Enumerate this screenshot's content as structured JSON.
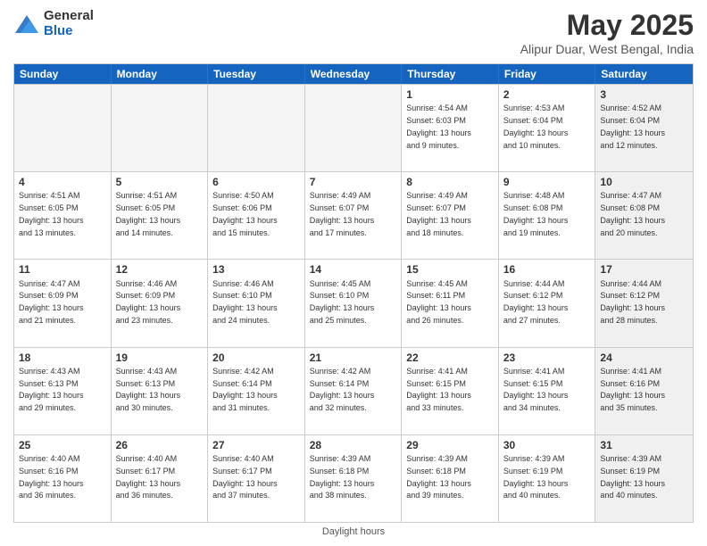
{
  "header": {
    "logo_general": "General",
    "logo_blue": "Blue",
    "title": "May 2025",
    "location": "Alipur Duar, West Bengal, India"
  },
  "days_of_week": [
    "Sunday",
    "Monday",
    "Tuesday",
    "Wednesday",
    "Thursday",
    "Friday",
    "Saturday"
  ],
  "weeks": [
    [
      {
        "num": "",
        "info": "",
        "empty": true
      },
      {
        "num": "",
        "info": "",
        "empty": true
      },
      {
        "num": "",
        "info": "",
        "empty": true
      },
      {
        "num": "",
        "info": "",
        "empty": true
      },
      {
        "num": "1",
        "info": "Sunrise: 4:54 AM\nSunset: 6:03 PM\nDaylight: 13 hours\nand 9 minutes."
      },
      {
        "num": "2",
        "info": "Sunrise: 4:53 AM\nSunset: 6:04 PM\nDaylight: 13 hours\nand 10 minutes."
      },
      {
        "num": "3",
        "info": "Sunrise: 4:52 AM\nSunset: 6:04 PM\nDaylight: 13 hours\nand 12 minutes.",
        "shaded": true
      }
    ],
    [
      {
        "num": "4",
        "info": "Sunrise: 4:51 AM\nSunset: 6:05 PM\nDaylight: 13 hours\nand 13 minutes."
      },
      {
        "num": "5",
        "info": "Sunrise: 4:51 AM\nSunset: 6:05 PM\nDaylight: 13 hours\nand 14 minutes."
      },
      {
        "num": "6",
        "info": "Sunrise: 4:50 AM\nSunset: 6:06 PM\nDaylight: 13 hours\nand 15 minutes."
      },
      {
        "num": "7",
        "info": "Sunrise: 4:49 AM\nSunset: 6:07 PM\nDaylight: 13 hours\nand 17 minutes."
      },
      {
        "num": "8",
        "info": "Sunrise: 4:49 AM\nSunset: 6:07 PM\nDaylight: 13 hours\nand 18 minutes."
      },
      {
        "num": "9",
        "info": "Sunrise: 4:48 AM\nSunset: 6:08 PM\nDaylight: 13 hours\nand 19 minutes."
      },
      {
        "num": "10",
        "info": "Sunrise: 4:47 AM\nSunset: 6:08 PM\nDaylight: 13 hours\nand 20 minutes.",
        "shaded": true
      }
    ],
    [
      {
        "num": "11",
        "info": "Sunrise: 4:47 AM\nSunset: 6:09 PM\nDaylight: 13 hours\nand 21 minutes."
      },
      {
        "num": "12",
        "info": "Sunrise: 4:46 AM\nSunset: 6:09 PM\nDaylight: 13 hours\nand 23 minutes."
      },
      {
        "num": "13",
        "info": "Sunrise: 4:46 AM\nSunset: 6:10 PM\nDaylight: 13 hours\nand 24 minutes."
      },
      {
        "num": "14",
        "info": "Sunrise: 4:45 AM\nSunset: 6:10 PM\nDaylight: 13 hours\nand 25 minutes."
      },
      {
        "num": "15",
        "info": "Sunrise: 4:45 AM\nSunset: 6:11 PM\nDaylight: 13 hours\nand 26 minutes."
      },
      {
        "num": "16",
        "info": "Sunrise: 4:44 AM\nSunset: 6:12 PM\nDaylight: 13 hours\nand 27 minutes."
      },
      {
        "num": "17",
        "info": "Sunrise: 4:44 AM\nSunset: 6:12 PM\nDaylight: 13 hours\nand 28 minutes.",
        "shaded": true
      }
    ],
    [
      {
        "num": "18",
        "info": "Sunrise: 4:43 AM\nSunset: 6:13 PM\nDaylight: 13 hours\nand 29 minutes."
      },
      {
        "num": "19",
        "info": "Sunrise: 4:43 AM\nSunset: 6:13 PM\nDaylight: 13 hours\nand 30 minutes."
      },
      {
        "num": "20",
        "info": "Sunrise: 4:42 AM\nSunset: 6:14 PM\nDaylight: 13 hours\nand 31 minutes."
      },
      {
        "num": "21",
        "info": "Sunrise: 4:42 AM\nSunset: 6:14 PM\nDaylight: 13 hours\nand 32 minutes."
      },
      {
        "num": "22",
        "info": "Sunrise: 4:41 AM\nSunset: 6:15 PM\nDaylight: 13 hours\nand 33 minutes."
      },
      {
        "num": "23",
        "info": "Sunrise: 4:41 AM\nSunset: 6:15 PM\nDaylight: 13 hours\nand 34 minutes."
      },
      {
        "num": "24",
        "info": "Sunrise: 4:41 AM\nSunset: 6:16 PM\nDaylight: 13 hours\nand 35 minutes.",
        "shaded": true
      }
    ],
    [
      {
        "num": "25",
        "info": "Sunrise: 4:40 AM\nSunset: 6:16 PM\nDaylight: 13 hours\nand 36 minutes."
      },
      {
        "num": "26",
        "info": "Sunrise: 4:40 AM\nSunset: 6:17 PM\nDaylight: 13 hours\nand 36 minutes."
      },
      {
        "num": "27",
        "info": "Sunrise: 4:40 AM\nSunset: 6:17 PM\nDaylight: 13 hours\nand 37 minutes."
      },
      {
        "num": "28",
        "info": "Sunrise: 4:39 AM\nSunset: 6:18 PM\nDaylight: 13 hours\nand 38 minutes."
      },
      {
        "num": "29",
        "info": "Sunrise: 4:39 AM\nSunset: 6:18 PM\nDaylight: 13 hours\nand 39 minutes."
      },
      {
        "num": "30",
        "info": "Sunrise: 4:39 AM\nSunset: 6:19 PM\nDaylight: 13 hours\nand 40 minutes."
      },
      {
        "num": "31",
        "info": "Sunrise: 4:39 AM\nSunset: 6:19 PM\nDaylight: 13 hours\nand 40 minutes.",
        "shaded": true
      }
    ]
  ],
  "footer": "Daylight hours"
}
